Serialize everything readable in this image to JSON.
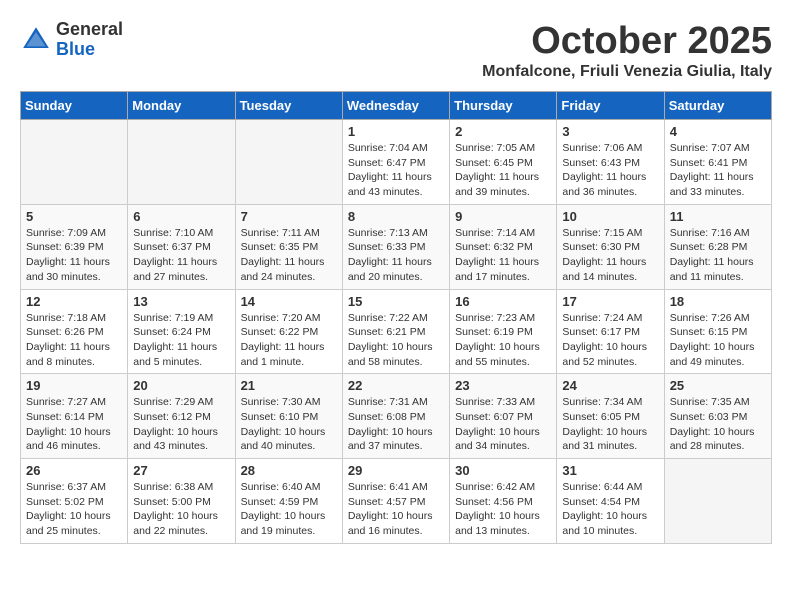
{
  "header": {
    "logo_general": "General",
    "logo_blue": "Blue",
    "month_title": "October 2025",
    "location": "Monfalcone, Friuli Venezia Giulia, Italy"
  },
  "weekdays": [
    "Sunday",
    "Monday",
    "Tuesday",
    "Wednesday",
    "Thursday",
    "Friday",
    "Saturday"
  ],
  "weeks": [
    [
      {
        "day": "",
        "info": ""
      },
      {
        "day": "",
        "info": ""
      },
      {
        "day": "",
        "info": ""
      },
      {
        "day": "1",
        "info": "Sunrise: 7:04 AM\nSunset: 6:47 PM\nDaylight: 11 hours\nand 43 minutes."
      },
      {
        "day": "2",
        "info": "Sunrise: 7:05 AM\nSunset: 6:45 PM\nDaylight: 11 hours\nand 39 minutes."
      },
      {
        "day": "3",
        "info": "Sunrise: 7:06 AM\nSunset: 6:43 PM\nDaylight: 11 hours\nand 36 minutes."
      },
      {
        "day": "4",
        "info": "Sunrise: 7:07 AM\nSunset: 6:41 PM\nDaylight: 11 hours\nand 33 minutes."
      }
    ],
    [
      {
        "day": "5",
        "info": "Sunrise: 7:09 AM\nSunset: 6:39 PM\nDaylight: 11 hours\nand 30 minutes."
      },
      {
        "day": "6",
        "info": "Sunrise: 7:10 AM\nSunset: 6:37 PM\nDaylight: 11 hours\nand 27 minutes."
      },
      {
        "day": "7",
        "info": "Sunrise: 7:11 AM\nSunset: 6:35 PM\nDaylight: 11 hours\nand 24 minutes."
      },
      {
        "day": "8",
        "info": "Sunrise: 7:13 AM\nSunset: 6:33 PM\nDaylight: 11 hours\nand 20 minutes."
      },
      {
        "day": "9",
        "info": "Sunrise: 7:14 AM\nSunset: 6:32 PM\nDaylight: 11 hours\nand 17 minutes."
      },
      {
        "day": "10",
        "info": "Sunrise: 7:15 AM\nSunset: 6:30 PM\nDaylight: 11 hours\nand 14 minutes."
      },
      {
        "day": "11",
        "info": "Sunrise: 7:16 AM\nSunset: 6:28 PM\nDaylight: 11 hours\nand 11 minutes."
      }
    ],
    [
      {
        "day": "12",
        "info": "Sunrise: 7:18 AM\nSunset: 6:26 PM\nDaylight: 11 hours\nand 8 minutes."
      },
      {
        "day": "13",
        "info": "Sunrise: 7:19 AM\nSunset: 6:24 PM\nDaylight: 11 hours\nand 5 minutes."
      },
      {
        "day": "14",
        "info": "Sunrise: 7:20 AM\nSunset: 6:22 PM\nDaylight: 11 hours\nand 1 minute."
      },
      {
        "day": "15",
        "info": "Sunrise: 7:22 AM\nSunset: 6:21 PM\nDaylight: 10 hours\nand 58 minutes."
      },
      {
        "day": "16",
        "info": "Sunrise: 7:23 AM\nSunset: 6:19 PM\nDaylight: 10 hours\nand 55 minutes."
      },
      {
        "day": "17",
        "info": "Sunrise: 7:24 AM\nSunset: 6:17 PM\nDaylight: 10 hours\nand 52 minutes."
      },
      {
        "day": "18",
        "info": "Sunrise: 7:26 AM\nSunset: 6:15 PM\nDaylight: 10 hours\nand 49 minutes."
      }
    ],
    [
      {
        "day": "19",
        "info": "Sunrise: 7:27 AM\nSunset: 6:14 PM\nDaylight: 10 hours\nand 46 minutes."
      },
      {
        "day": "20",
        "info": "Sunrise: 7:29 AM\nSunset: 6:12 PM\nDaylight: 10 hours\nand 43 minutes."
      },
      {
        "day": "21",
        "info": "Sunrise: 7:30 AM\nSunset: 6:10 PM\nDaylight: 10 hours\nand 40 minutes."
      },
      {
        "day": "22",
        "info": "Sunrise: 7:31 AM\nSunset: 6:08 PM\nDaylight: 10 hours\nand 37 minutes."
      },
      {
        "day": "23",
        "info": "Sunrise: 7:33 AM\nSunset: 6:07 PM\nDaylight: 10 hours\nand 34 minutes."
      },
      {
        "day": "24",
        "info": "Sunrise: 7:34 AM\nSunset: 6:05 PM\nDaylight: 10 hours\nand 31 minutes."
      },
      {
        "day": "25",
        "info": "Sunrise: 7:35 AM\nSunset: 6:03 PM\nDaylight: 10 hours\nand 28 minutes."
      }
    ],
    [
      {
        "day": "26",
        "info": "Sunrise: 6:37 AM\nSunset: 5:02 PM\nDaylight: 10 hours\nand 25 minutes."
      },
      {
        "day": "27",
        "info": "Sunrise: 6:38 AM\nSunset: 5:00 PM\nDaylight: 10 hours\nand 22 minutes."
      },
      {
        "day": "28",
        "info": "Sunrise: 6:40 AM\nSunset: 4:59 PM\nDaylight: 10 hours\nand 19 minutes."
      },
      {
        "day": "29",
        "info": "Sunrise: 6:41 AM\nSunset: 4:57 PM\nDaylight: 10 hours\nand 16 minutes."
      },
      {
        "day": "30",
        "info": "Sunrise: 6:42 AM\nSunset: 4:56 PM\nDaylight: 10 hours\nand 13 minutes."
      },
      {
        "day": "31",
        "info": "Sunrise: 6:44 AM\nSunset: 4:54 PM\nDaylight: 10 hours\nand 10 minutes."
      },
      {
        "day": "",
        "info": ""
      }
    ]
  ]
}
